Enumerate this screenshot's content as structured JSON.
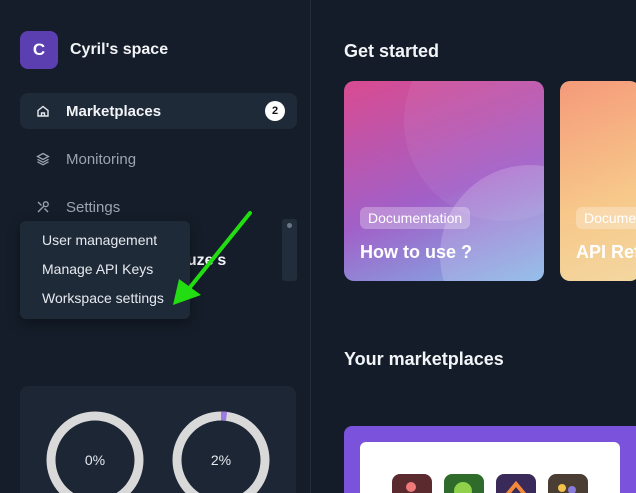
{
  "workspace": {
    "initial": "C",
    "name": "Cyril's space"
  },
  "nav": {
    "marketplaces": {
      "label": "Marketplaces",
      "icon": "home-icon",
      "badge": "2"
    },
    "monitoring": {
      "label": "Monitoring",
      "icon": "layers-icon"
    },
    "settings": {
      "label": "Settings",
      "icon": "tools-icon"
    }
  },
  "partial_heading": "vuze's",
  "settings_menu": {
    "items": [
      "User management",
      "Manage API Keys",
      "Workspace settings"
    ]
  },
  "stats": {
    "ring_1": "0%",
    "ring_2": "2%",
    "ring_1_progress": 0.0,
    "ring_2_progress": 0.02
  },
  "main": {
    "get_started_title": "Get started",
    "cards": [
      {
        "tag": "Documentation",
        "title": "How to use ?"
      },
      {
        "tag": "Docume",
        "title": "API Ref"
      }
    ],
    "marketplaces_title": "Your marketplaces"
  },
  "colors": {
    "background": "#131c28",
    "accent_purple": "#5b3fb0",
    "marketplace_card": "#7a52db",
    "annotation_arrow": "#22dd11"
  }
}
